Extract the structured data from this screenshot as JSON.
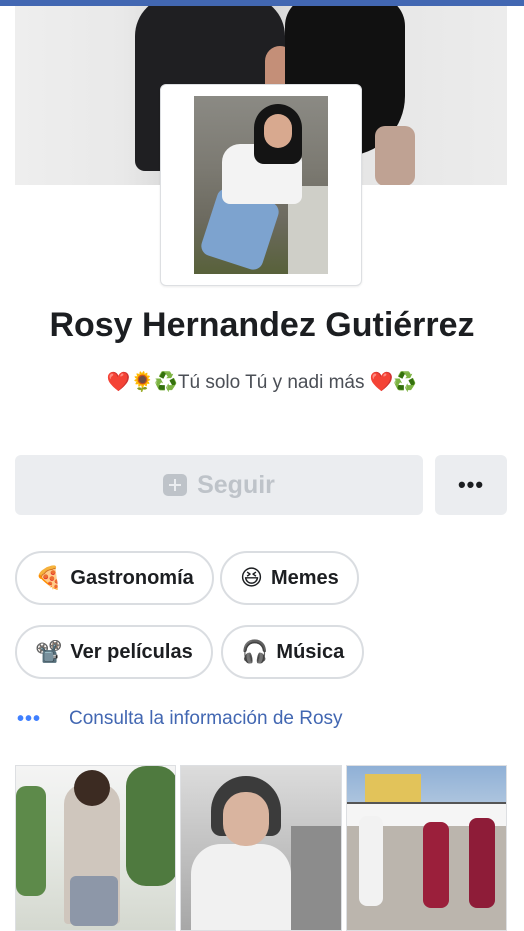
{
  "profile": {
    "name": "Rosy Hernandez Gutiérrez",
    "bio": "❤️🌻♻️Tú solo Tú y nadi más ❤️♻️"
  },
  "actions": {
    "follow_label": "Seguir",
    "more_label": "•••"
  },
  "interests": [
    {
      "emoji": "🍕",
      "label": "Gastronomía"
    },
    {
      "emoji": "😆",
      "label": "Memes"
    },
    {
      "emoji": "📽️",
      "label": "Ver películas"
    },
    {
      "emoji": "🎧",
      "label": "Música"
    }
  ],
  "info_link": {
    "dots": "•••",
    "text": "Consulta la información de Rosy"
  },
  "colors": {
    "brand": "#4267b2",
    "link": "#4267b2",
    "button_bg": "#ebedf0",
    "button_disabled_text": "#bec3c9"
  }
}
